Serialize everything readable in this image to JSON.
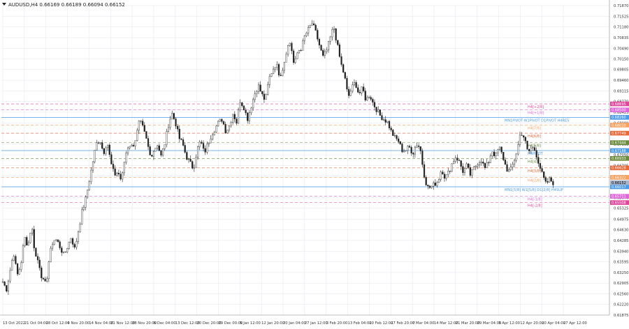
{
  "header": {
    "symbol_line": "AUDUSD,H4  0.66169 0.66189 0.66094 0.66152",
    "triangle_icon": "down-triangle-icon"
  },
  "colors": {
    "background": "#ffffff",
    "grid": "#e4e4ec",
    "candle": "#222222",
    "h4_line": "#ff66cc",
    "pivot_blue": "#4a9be8",
    "price_badge": "#cfd6e6"
  },
  "chart_data": {
    "type": "candlestick",
    "symbol": "AUDUSD",
    "timeframe": "H4",
    "ohlc": {
      "open": 0.66169,
      "high": 0.66189,
      "low": 0.66094,
      "close": 0.66152
    },
    "ylim": [
      0.61875,
      0.7187
    ],
    "grid": true,
    "y_ticks": [
      "0.71870",
      "0.71525",
      "0.71180",
      "0.70835",
      "0.70490",
      "0.70150",
      "0.69805",
      "0.69460",
      "0.69115",
      "0.68770",
      "0.68425",
      "0.68080",
      "0.67740",
      "0.67395",
      "0.67050",
      "0.66705",
      "0.66360",
      "0.66015",
      "0.65670",
      "0.65325",
      "0.64975",
      "0.64630",
      "0.64285",
      "0.63940",
      "0.63595",
      "0.63250",
      "0.62905",
      "0.62560",
      "0.62220",
      "0.61875"
    ],
    "x_ticks": [
      "13 Oct 2022",
      "21 Oct 04:00",
      "28 Oct 12:00",
      "4 Nov 20:00",
      "14 Nov 04:00",
      "21 Nov 12:00",
      "28 Nov 20:00",
      "6 Dec 04:00",
      "13 Dec 12:00",
      "20 Dec 20:00",
      "29 Dec 00:00",
      "5 Jan 12:00",
      "12 Jan 20:00",
      "20 Jan 04:00",
      "27 Jan 12:00",
      "3 Feb 20:00",
      "13 Feb 04:00",
      "20 Feb 12:00",
      "27 Feb 20:00",
      "7 Mar 04:00",
      "14 Mar 12:00",
      "21 Mar 20:00",
      "29 Mar 04:00",
      "5 Apr 12:00",
      "12 Apr 20:00",
      "20 Apr 04:00",
      "27 Apr 12:00"
    ],
    "close_path": [
      0.6295,
      0.627,
      0.633,
      0.639,
      0.6315,
      0.635,
      0.644,
      0.641,
      0.648,
      0.638,
      0.636,
      0.63,
      0.6285,
      0.638,
      0.643,
      0.643,
      0.6405,
      0.638,
      0.641,
      0.644,
      0.64,
      0.646,
      0.652,
      0.656,
      0.662,
      0.668,
      0.674,
      0.6755,
      0.671,
      0.675,
      0.668,
      0.664,
      0.665,
      0.662,
      0.67,
      0.674,
      0.673,
      0.676,
      0.6815,
      0.679,
      0.675,
      0.67,
      0.672,
      0.674,
      0.67,
      0.674,
      0.68,
      0.684,
      0.681,
      0.676,
      0.674,
      0.67,
      0.668,
      0.666,
      0.672,
      0.675,
      0.671,
      0.674,
      0.677,
      0.679,
      0.681,
      0.682,
      0.678,
      0.68,
      0.684,
      0.681,
      0.688,
      0.686,
      0.682,
      0.686,
      0.69,
      0.693,
      0.69,
      0.688,
      0.695,
      0.698,
      0.7,
      0.696,
      0.699,
      0.705,
      0.707,
      0.699,
      0.704,
      0.705,
      0.709,
      0.711,
      0.713,
      0.71,
      0.706,
      0.702,
      0.704,
      0.708,
      0.712,
      0.706,
      0.7,
      0.696,
      0.689,
      0.692,
      0.694,
      0.69,
      0.692,
      0.688,
      0.69,
      0.687,
      0.685,
      0.683,
      0.682,
      0.681,
      0.678,
      0.676,
      0.675,
      0.672,
      0.672,
      0.673,
      0.671,
      0.674,
      0.673,
      0.665,
      0.66,
      0.66,
      0.661,
      0.662,
      0.666,
      0.663,
      0.665,
      0.668,
      0.67,
      0.668,
      0.665,
      0.667,
      0.664,
      0.666,
      0.668,
      0.669,
      0.666,
      0.668,
      0.672,
      0.67,
      0.673,
      0.67,
      0.666,
      0.665,
      0.668,
      0.672,
      0.678,
      0.676,
      0.671,
      0.673,
      0.672,
      0.668,
      0.664,
      0.661,
      0.6625,
      0.6615
    ]
  },
  "levels": [
    {
      "label": "H4[+2/8]",
      "value": 0.68695,
      "color": "#e0449b",
      "style": "dash",
      "badge": "0.68695"
    },
    {
      "label": "H4[+1/8]",
      "value": 0.685,
      "color": "#e066d8",
      "style": "dash",
      "badge": "0.68500"
    },
    {
      "label": "MN1PIVOT W1PIVOT D1PIVOT H4RES",
      "value": 0.6826,
      "color": "#4a9be8",
      "style": "solid",
      "badge": "0.68260"
    },
    {
      "label": "H4[7/8]",
      "value": 0.6801,
      "color": "#f7a15e",
      "style": "dash",
      "badge": "0.68010"
    },
    {
      "label": "H4[6/8]",
      "value": 0.67749,
      "color": "#e8683a",
      "style": "dash",
      "badge": "0.67749"
    },
    {
      "label": "H4[5/8]",
      "value": 0.67444,
      "color": "#6a8a3c",
      "style": "dash",
      "badge": "0.67444"
    },
    {
      "label": "H4PIVOT",
      "value": 0.67188,
      "color": "#4a9be8",
      "style": "solid",
      "badge": "0.67188"
    },
    {
      "label": "H4[4/8]",
      "value": 0.66933,
      "color": "#6a8a3c",
      "style": "dash",
      "badge": "0.66933"
    },
    {
      "label": "H4[3/8]",
      "value": 0.66628,
      "color": "#e8683a",
      "style": "dash",
      "badge": "0.66628"
    },
    {
      "label": "H4[2/8]",
      "value": 0.66322,
      "color": "#f7a15e",
      "style": "dash",
      "badge": "0.66322"
    },
    {
      "label": "MN1[5/8] W1[5/8] D1[2/8] H4SUP",
      "value": 0.66017,
      "color": "#4a9be8",
      "style": "solid",
      "badge": "0.66017"
    },
    {
      "label": "H4[-1/8]",
      "value": 0.65711,
      "color": "#e066d8",
      "style": "dash",
      "badge": "0.65711"
    },
    {
      "label": "H4[-2/8]",
      "value": 0.65508,
      "color": "#e0449b",
      "style": "dash",
      "badge": "0.65508"
    }
  ],
  "current_price": {
    "value": "0.66152",
    "color": "#a7b3c8"
  }
}
